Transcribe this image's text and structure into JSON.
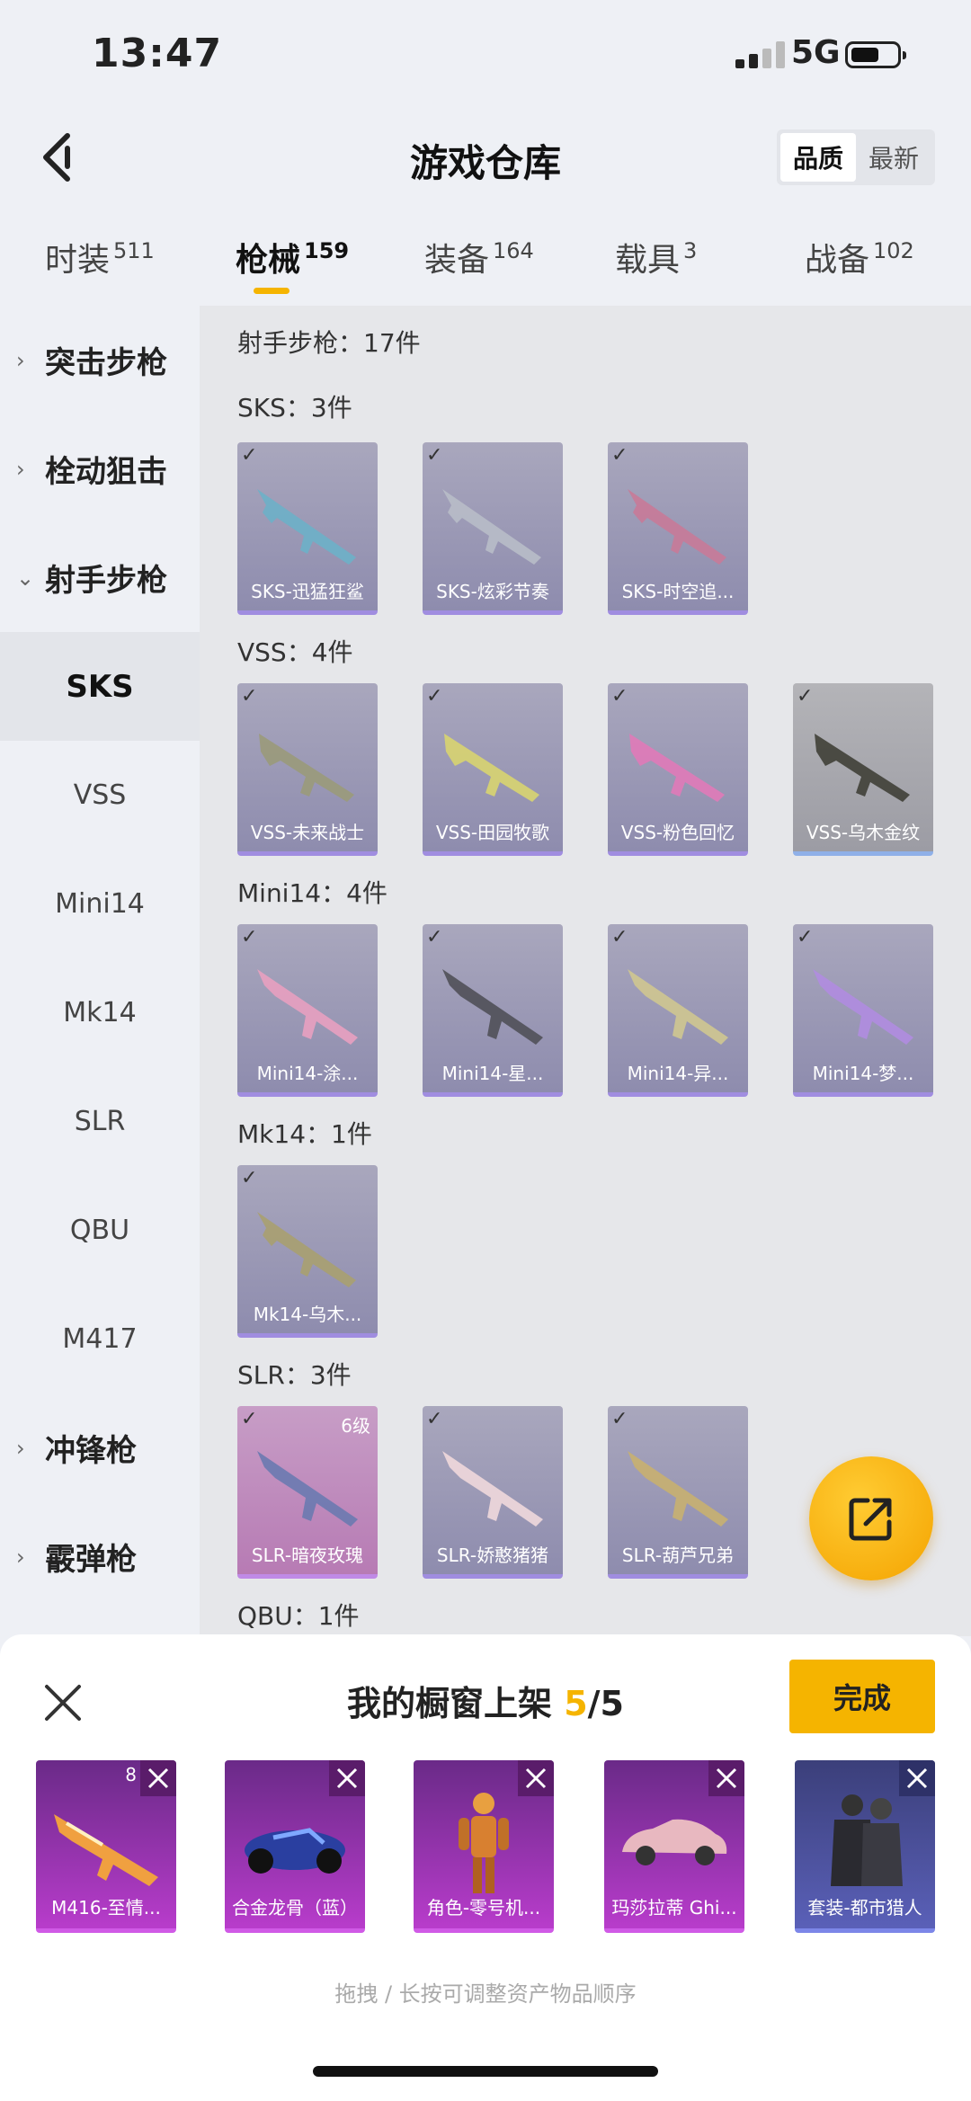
{
  "status": {
    "time": "13:47",
    "network": "5G"
  },
  "header": {
    "title": "游戏仓库",
    "sort_quality": "品质",
    "sort_newest": "最新"
  },
  "tabs": [
    {
      "label": "时装",
      "count": "511"
    },
    {
      "label": "枪械",
      "count": "159"
    },
    {
      "label": "装备",
      "count": "164"
    },
    {
      "label": "载具",
      "count": "3"
    },
    {
      "label": "战备",
      "count": "102"
    }
  ],
  "sidebar": {
    "assault": "突击步枪",
    "bolt": "栓动狙击",
    "marksman": "射手步枪",
    "subs": [
      "SKS",
      "VSS",
      "Mini14",
      "Mk14",
      "SLR",
      "QBU",
      "M417"
    ],
    "smg": "冲锋枪",
    "shotgun": "霰弹枪"
  },
  "content": {
    "category_count": "射手步枪：17件",
    "sections": [
      {
        "label": "SKS：3件",
        "items": [
          "SKS-迅猛狂鲨",
          "SKS-炫彩节奏",
          "SKS-时空追..."
        ]
      },
      {
        "label": "VSS：4件",
        "items": [
          "VSS-未来战士",
          "VSS-田园牧歌",
          "VSS-粉色回忆",
          "VSS-乌木金纹"
        ]
      },
      {
        "label": "Mini14：4件",
        "items": [
          "Mini14-涂...",
          "Mini14-星...",
          "Mini14-异...",
          "Mini14-梦..."
        ]
      },
      {
        "label": "Mk14：1件",
        "items": [
          "Mk14-乌木..."
        ]
      },
      {
        "label": "SLR：3件",
        "items": [
          "SLR-暗夜玫瑰",
          "SLR-娇憨猪猪",
          "SLR-葫芦兄弟"
        ],
        "level": "6级"
      },
      {
        "label": "QBU：1件"
      }
    ]
  },
  "sheet": {
    "title_prefix": "我的橱窗上架 ",
    "count": "5",
    "total": "/5",
    "done": "完成",
    "items": [
      "M416-至情...",
      "合金龙骨（蓝）",
      "角色-零号机...",
      "玛莎拉蒂 Ghi...",
      "套装-都市猎人"
    ],
    "first_badge": "8",
    "hint": "拖拽 / 长按可调整资产物品顺序"
  },
  "colors": {
    "accent": "#f5b400",
    "bg": "#eef0f5"
  }
}
